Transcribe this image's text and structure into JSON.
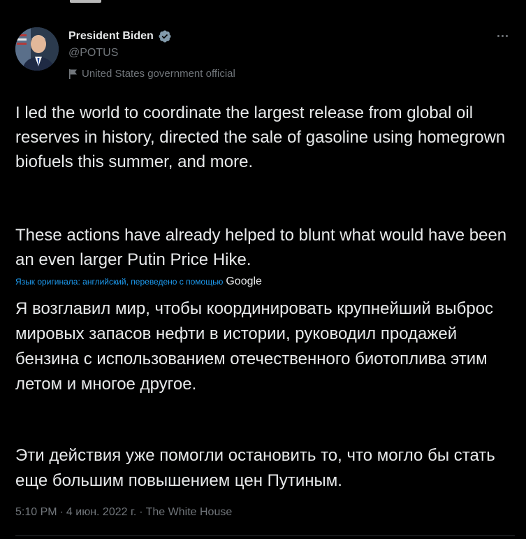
{
  "author": {
    "name": "President Biden",
    "handle": "@POTUS",
    "label": "United States government official"
  },
  "tweet": {
    "paragraph1": "I led the world to coordinate the largest release from global oil reserves in history, directed the sale of gasoline using homegrown biofuels this summer, and more.",
    "paragraph2": "These actions have already helped to blunt what would have been an even larger Putin Price Hike."
  },
  "translation": {
    "attribution": "Язык оригинала: английский, переведено с помощью",
    "provider": "Google",
    "paragraph1": "Я возглавил мир, чтобы координировать крупнейший выброс мировых запасов нефти в истории, руководил продажей бензина с использованием отечественного биотоплива этим летом и многое другое.",
    "paragraph2": " Эти действия уже помогли остановить то, что могло бы стать еще большим повышением цен Путиным."
  },
  "meta": {
    "time": "5:10 PM",
    "separator1": "·",
    "date": "4 июн. 2022 г.",
    "separator2": "·",
    "source": "The White House"
  },
  "colors": {
    "background": "#000000",
    "text": "#e7e9ea",
    "secondary": "#71767b",
    "link": "#1d9bf0",
    "verified_badge": "#829aab"
  },
  "icons": {
    "verified": "verified-badge-icon",
    "flag": "flag-icon",
    "more": "more-options-icon"
  }
}
